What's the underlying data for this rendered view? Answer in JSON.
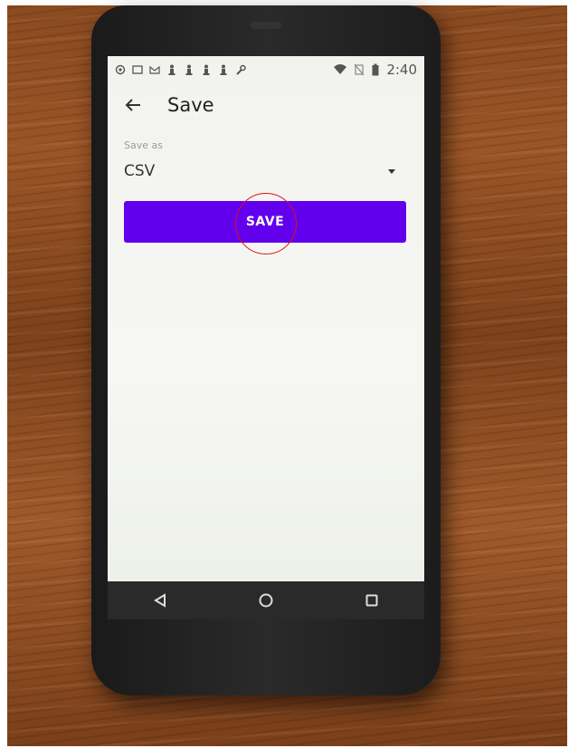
{
  "status_bar": {
    "time": "2:40",
    "icons": [
      "at-icon",
      "cast-icon",
      "gmail-icon",
      "chess-pawn-icon",
      "chess-pawn-icon",
      "chess-pawn-icon",
      "chess-pawn-icon",
      "wrench-icon",
      "wifi-icon",
      "no-sim-icon",
      "battery-icon"
    ]
  },
  "app_bar": {
    "title": "Save",
    "back_icon": "arrow-back-icon"
  },
  "form": {
    "save_as_label": "Save as",
    "format_value": "CSV",
    "save_button_label": "SAVE"
  },
  "nav_bar": {
    "icons": [
      "back-triangle-icon",
      "home-circle-icon",
      "recents-square-icon"
    ]
  },
  "colors": {
    "primary": "#6200ee",
    "highlight_ring": "#e01010"
  }
}
